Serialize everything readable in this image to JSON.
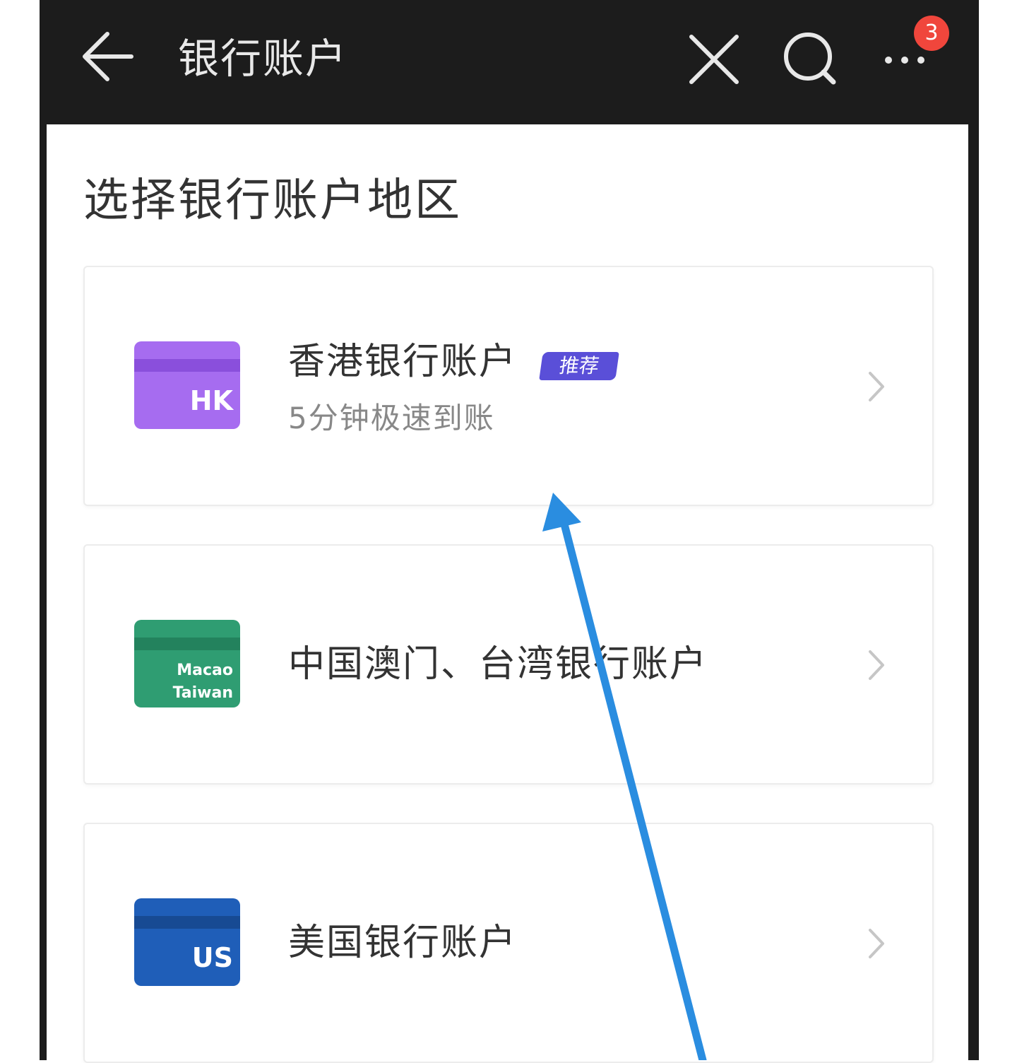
{
  "header": {
    "title": "银行账户",
    "badge_count": "3",
    "icons": [
      "back-arrow-icon",
      "close-icon",
      "search-icon",
      "more-icon"
    ]
  },
  "main": {
    "section_title": "选择银行账户地区",
    "cards": [
      {
        "flag_code": "HK",
        "title": "香港银行账户",
        "tag": "推荐",
        "subtitle": "5分钟极速到账",
        "flag_color": "#a66cf0",
        "stripe_color": "#8a4fdc"
      },
      {
        "flag_code_line1": "Macao",
        "flag_code_line2": "Taiwan",
        "title": "中国澳门、台湾银行账户",
        "flag_color": "#2f9d72",
        "stripe_color": "#23825d"
      },
      {
        "flag_code": "US",
        "title": "美国银行账户",
        "flag_color": "#1f5eb8",
        "stripe_color": "#174a93"
      }
    ]
  },
  "annotation": {
    "arrow_color": "#2a8de0"
  }
}
